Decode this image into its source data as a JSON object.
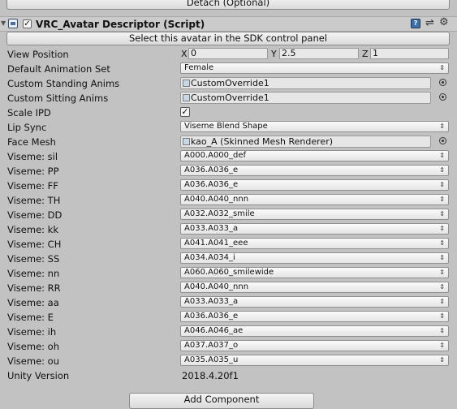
{
  "detach_label": "Detach (Optional)",
  "component": {
    "title": "VRC_Avatar Descriptor (Script)",
    "enabled_mark": "✓"
  },
  "select_avatar_label": "Select this avatar in the SDK control panel",
  "view_position": {
    "label": "View Position",
    "x_label": "X",
    "x": "0",
    "y_label": "Y",
    "y": "2.5",
    "z_label": "Z",
    "z": "1"
  },
  "default_animation_set": {
    "label": "Default Animation Set",
    "value": "Female"
  },
  "custom_standing_anims": {
    "label": "Custom Standing Anims",
    "value": "CustomOverride1"
  },
  "custom_sitting_anims": {
    "label": "Custom Sitting Anims",
    "value": "CustomOverride1"
  },
  "scale_ipd": {
    "label": "Scale IPD",
    "mark": "✓"
  },
  "lip_sync": {
    "label": "Lip Sync",
    "value": "Viseme Blend Shape"
  },
  "face_mesh": {
    "label": "Face Mesh",
    "value": "kao_A (Skinned Mesh Renderer)"
  },
  "visemes": [
    {
      "label": "Viseme: sil",
      "value": "A000.A000_def"
    },
    {
      "label": "Viseme: PP",
      "value": "A036.A036_e"
    },
    {
      "label": "Viseme: FF",
      "value": "A036.A036_e"
    },
    {
      "label": "Viseme: TH",
      "value": "A040.A040_nnn"
    },
    {
      "label": "Viseme: DD",
      "value": "A032.A032_smile"
    },
    {
      "label": "Viseme: kk",
      "value": "A033.A033_a"
    },
    {
      "label": "Viseme: CH",
      "value": "A041.A041_eee"
    },
    {
      "label": "Viseme: SS",
      "value": "A034.A034_i"
    },
    {
      "label": "Viseme: nn",
      "value": "A060.A060_smilewide"
    },
    {
      "label": "Viseme: RR",
      "value": "A040.A040_nnn"
    },
    {
      "label": "Viseme: aa",
      "value": "A033.A033_a"
    },
    {
      "label": "Viseme: E",
      "value": "A036.A036_e"
    },
    {
      "label": "Viseme: ih",
      "value": "A046.A046_ae"
    },
    {
      "label": "Viseme: oh",
      "value": "A037.A037_o"
    },
    {
      "label": "Viseme: ou",
      "value": "A035.A035_u"
    }
  ],
  "unity_version": {
    "label": "Unity Version",
    "value": "2018.4.20f1"
  },
  "add_component_label": "Add Component",
  "icons": {
    "fold": "▼",
    "dropdown_arrow": "⇕",
    "preset": "⇌",
    "gear": "⚙",
    "help": "?"
  }
}
